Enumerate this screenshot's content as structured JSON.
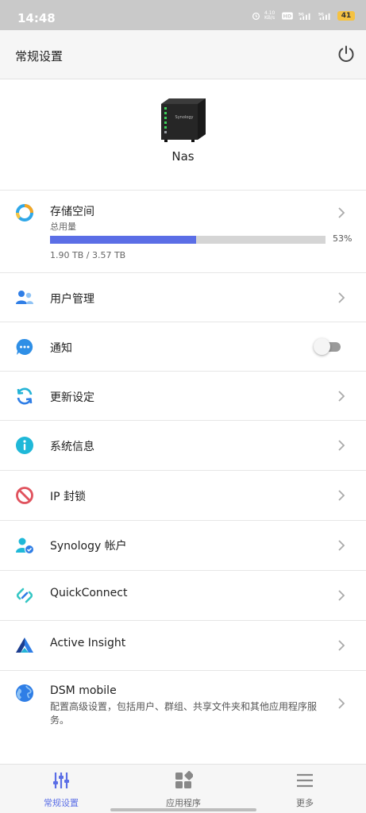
{
  "statusbar": {
    "time": "14:48",
    "netspeed": "4.10 KB/s",
    "battery": "41"
  },
  "header": {
    "title": "常规设置"
  },
  "device": {
    "name": "Nas",
    "brand": "Synology"
  },
  "storage": {
    "label": "存储空间",
    "sublabel": "总用量",
    "used_fraction": 0.53,
    "percent_text": "53%",
    "usage_text": "1.90 TB / 3.57 TB"
  },
  "menu": [
    {
      "label": "用户管理"
    },
    {
      "label": "通知",
      "toggle_on": false
    },
    {
      "label": "更新设定"
    },
    {
      "label": "系统信息"
    },
    {
      "label": "IP 封锁"
    },
    {
      "label": "Synology 帐户"
    },
    {
      "label": "QuickConnect"
    },
    {
      "label": "Active Insight"
    },
    {
      "label": "DSM mobile",
      "description": "配置高级设置，包括用户、群组、共享文件夹和其他应用程序服务。"
    }
  ],
  "tabs": [
    {
      "label": "常规设置",
      "active": true
    },
    {
      "label": "应用程序",
      "active": false
    },
    {
      "label": "更多",
      "active": false
    }
  ],
  "colors": {
    "accent": "#5b6ee6",
    "storage_bar_bg": "#d5d5d5",
    "statusbar": "#c9c9c9"
  }
}
